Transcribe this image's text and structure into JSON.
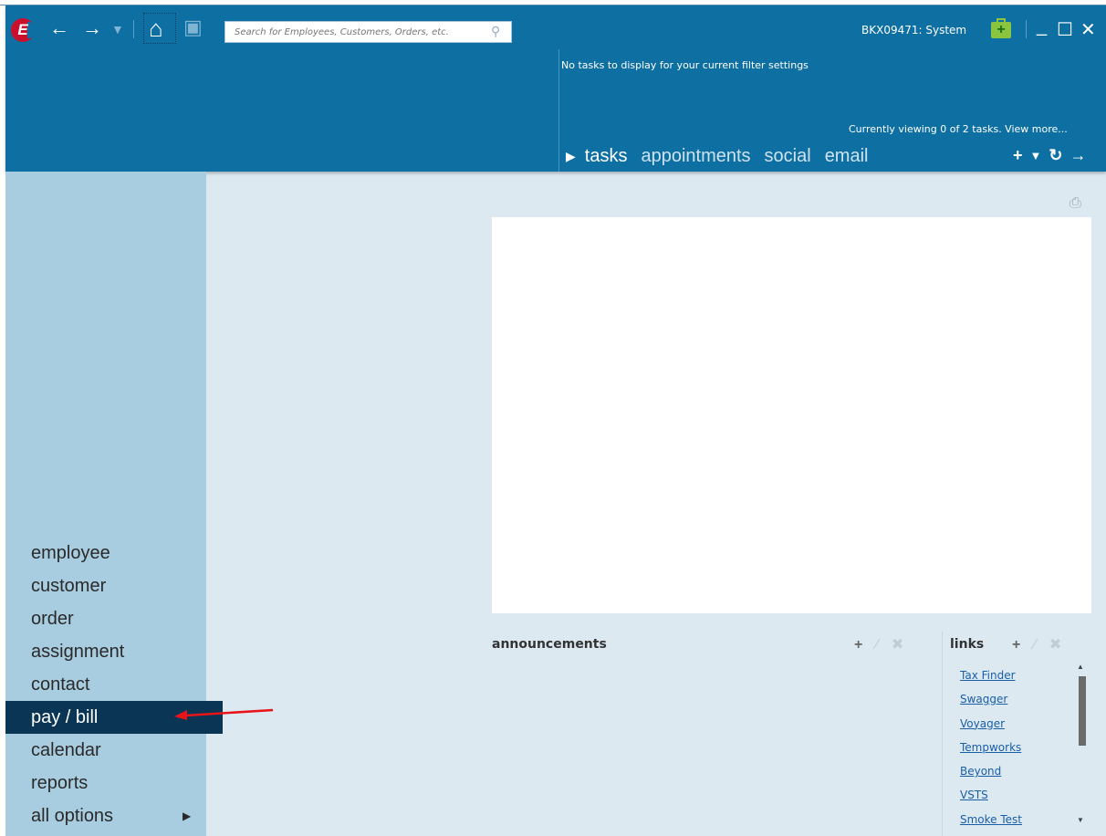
{
  "toolbar": {
    "logo_letter": "E",
    "back_icon": "←",
    "forward_icon": "→",
    "dropdown_icon": "▼",
    "home_icon": "⌂",
    "save_icon": "▣",
    "search_placeholder": "Search for Employees, Customers, Orders, etc.",
    "search_icon": "⚲",
    "user_label": "BKX09471: System",
    "kit_icon": "+",
    "minimize_icon": "_",
    "maximize_icon": "☐",
    "close_icon": "✕"
  },
  "tasks": {
    "message": "No tasks to display for your current filter settings",
    "viewing": "Currently viewing 0 of 2 tasks. View more...",
    "play_icon": "▶",
    "tabs": [
      {
        "label": "tasks"
      },
      {
        "label": "appointments"
      },
      {
        "label": "social"
      },
      {
        "label": "email"
      }
    ],
    "tools": {
      "add": "+",
      "filter": "▼",
      "refresh": "↻",
      "next": "→"
    }
  },
  "sidebar": {
    "items": [
      {
        "label": "employee"
      },
      {
        "label": "customer"
      },
      {
        "label": "order"
      },
      {
        "label": "assignment"
      },
      {
        "label": "contact"
      },
      {
        "label": "pay / bill"
      },
      {
        "label": "calendar"
      },
      {
        "label": "reports"
      },
      {
        "label": "all options"
      }
    ],
    "submenu_icon": "▶"
  },
  "content": {
    "print_icon": "⎙",
    "announcements_title": "announcements",
    "links_title": "links",
    "tool_add": "+",
    "tool_edit": "∕",
    "tool_delete": "✖",
    "links": [
      {
        "label": "Tax Finder"
      },
      {
        "label": "Swagger"
      },
      {
        "label": "Voyager"
      },
      {
        "label": "Tempworks"
      },
      {
        "label": "Beyond"
      },
      {
        "label": "VSTS"
      },
      {
        "label": "Smoke Test"
      }
    ],
    "scroll_up": "▲",
    "scroll_down": "▼"
  },
  "colors": {
    "header": "#0e6fa3",
    "sidebar": "#a9cde0",
    "active_nav": "#0a3554",
    "content_bg": "#dce9f1",
    "annotation_arrow": "#e8141a"
  }
}
